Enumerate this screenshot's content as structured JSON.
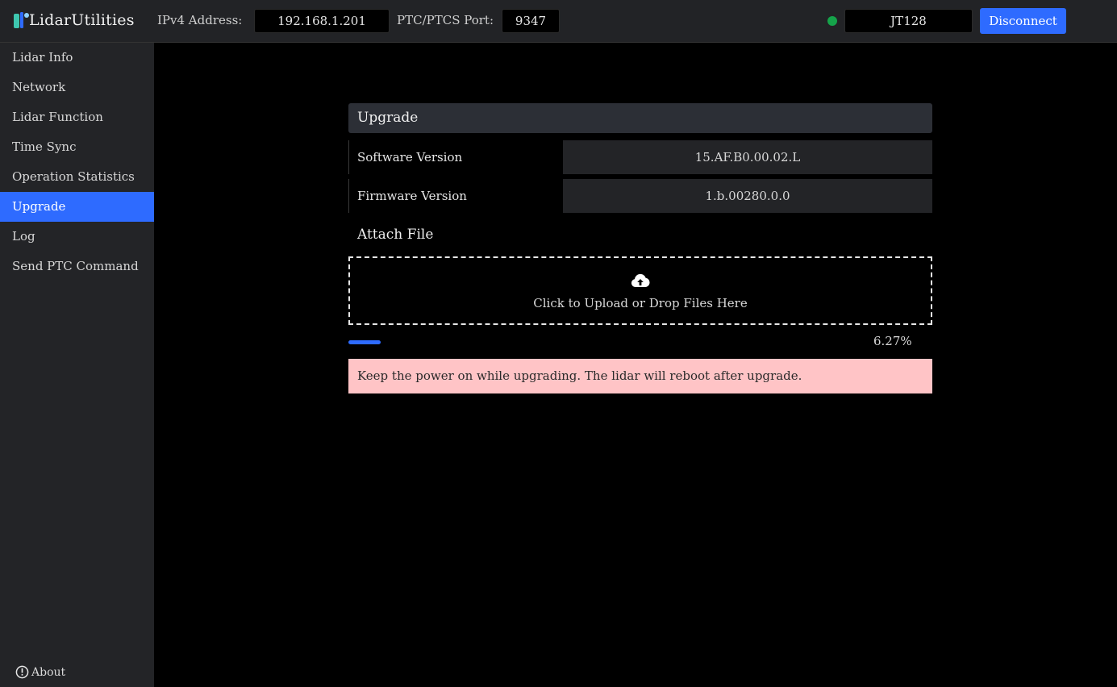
{
  "header": {
    "app_name": "LidarUtilities",
    "ip_label": "IPv4 Address:",
    "ip_value": "192.168.1.201",
    "port_label": "PTC/PTCS Port:",
    "port_value": "9347",
    "device_model": "JT128",
    "connection_status_color": "#15a34a",
    "disconnect_label": "Disconnect"
  },
  "sidebar": {
    "items": [
      {
        "label": "Lidar Info"
      },
      {
        "label": "Network"
      },
      {
        "label": "Lidar Function"
      },
      {
        "label": "Time Sync"
      },
      {
        "label": "Operation Statistics"
      },
      {
        "label": "Upgrade",
        "active": true
      },
      {
        "label": "Log"
      },
      {
        "label": "Send PTC Command"
      }
    ],
    "about_label": "About"
  },
  "upgrade": {
    "title": "Upgrade",
    "software_version_label": "Software Version",
    "software_version": "15.AF.B0.00.02.L",
    "firmware_version_label": "Firmware Version",
    "firmware_version": "1.b.00280.0.0",
    "attach_file_label": "Attach File",
    "upload_text": "Click to Upload or Drop Files Here",
    "progress_percent": 6.27,
    "progress_text": "6.27%",
    "warning_text": "Keep the power on while upgrading. The lidar will reboot after upgrade."
  },
  "colors": {
    "accent": "#2e6bff",
    "warning_bg": "#ffc4c6",
    "status_connected": "#15a34a"
  },
  "icons": {
    "logo": "lidar-logo-icon",
    "upload": "cloud-upload-icon",
    "about": "info-circle-icon"
  }
}
